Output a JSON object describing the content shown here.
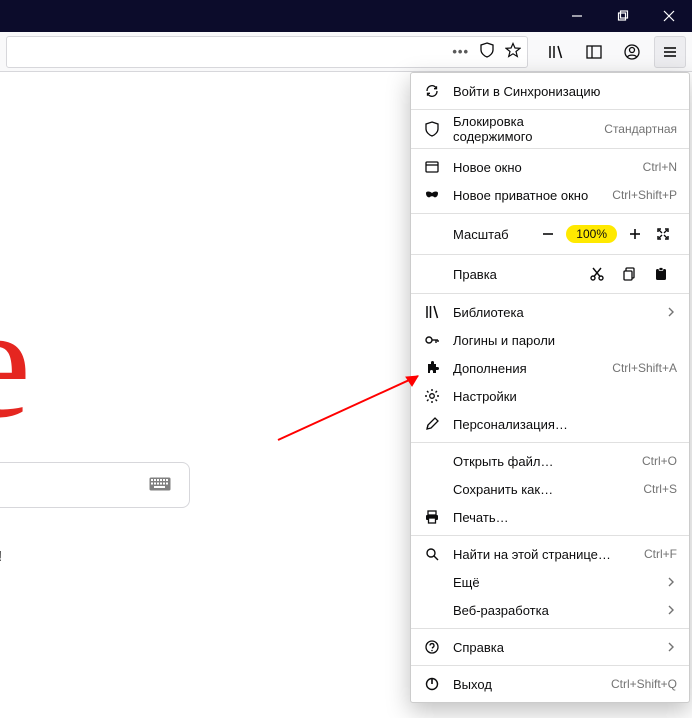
{
  "logo_letter": "e",
  "promo_fragment": "!",
  "zoom_value": "100%",
  "menu": {
    "sync": "Войти в Синхронизацию",
    "content_blocking": "Блокировка содержимого",
    "content_blocking_mode": "Стандартная",
    "new_window": "Новое окно",
    "new_window_sc": "Ctrl+N",
    "new_private": "Новое приватное окно",
    "new_private_sc": "Ctrl+Shift+P",
    "zoom_label": "Масштаб",
    "edit_label": "Правка",
    "library": "Библиотека",
    "logins": "Логины и пароли",
    "addons": "Дополнения",
    "addons_sc": "Ctrl+Shift+A",
    "settings": "Настройки",
    "customize": "Персонализация…",
    "open_file": "Открыть файл…",
    "open_file_sc": "Ctrl+O",
    "save_as": "Сохранить как…",
    "save_as_sc": "Ctrl+S",
    "print": "Печать…",
    "find": "Найти на этой странице…",
    "find_sc": "Ctrl+F",
    "more": "Ещё",
    "webdev": "Веб-разработка",
    "help": "Справка",
    "exit": "Выход",
    "exit_sc": "Ctrl+Shift+Q"
  }
}
